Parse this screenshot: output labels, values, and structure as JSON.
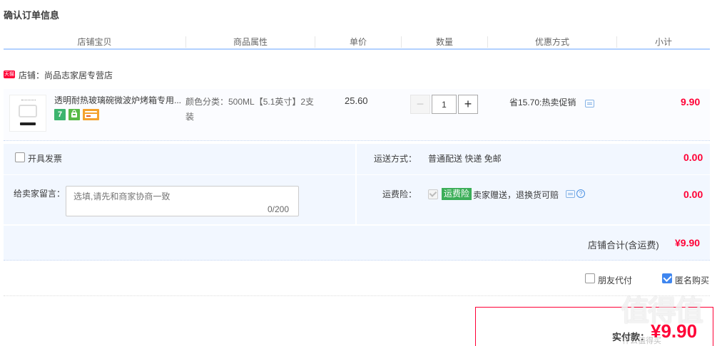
{
  "page_title": "确认订单信息",
  "columns": [
    "店铺宝贝",
    "商品属性",
    "单价",
    "数量",
    "优惠方式",
    "小计"
  ],
  "shop": {
    "icon_label": "天猫",
    "name": "店铺：尚品志家居专营店"
  },
  "item": {
    "title": "透明耐热玻璃碗微波炉烤箱专用...",
    "badges": [
      "7",
      "",
      ""
    ],
    "attributes": "颜色分类：500ML【5.1英寸】2支装",
    "unit_price": "25.60",
    "quantity": "1",
    "qty_minus": "−",
    "qty_plus": "+",
    "discount": "省15.70:热卖促销",
    "subtotal": "9.90"
  },
  "options": {
    "invoice_label": "开具发票",
    "shipping_label": "运送方式：",
    "shipping_value": "普通配送 快递 免邮",
    "shipping_amount": "0.00",
    "message_label": "给卖家留言：",
    "message_placeholder": "选填,请先和商家协商一致",
    "message_count": "0/200",
    "insurance_label": "运费险：",
    "insurance_tag": "运费险",
    "insurance_text": "卖家赠送，退换货可赔",
    "insurance_amount": "0.00"
  },
  "shop_total": {
    "label": "店铺合计(含运费)",
    "amount": "¥9.90"
  },
  "footer_options": {
    "friend_pay": "朋友代付",
    "anonymous": "匿名购买",
    "anonymous_checked": true
  },
  "payment": {
    "label": "实付款：",
    "amount": "¥9.90"
  },
  "watermark": {
    "main": "值得值",
    "sub": "什么值得买"
  },
  "colors": {
    "accent_red": "#ff0036",
    "panel_blue": "#f2f7ff",
    "header_line": "#b2d1ff",
    "checkbox_blue": "#3f86ef",
    "insurance_green": "#3cae58"
  }
}
